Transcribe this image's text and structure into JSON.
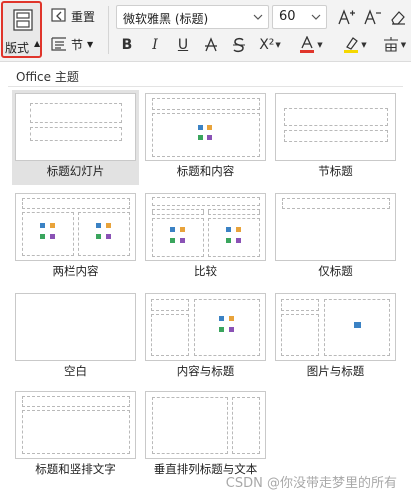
{
  "ribbon": {
    "layout_label": "版式",
    "reset_label": "重置",
    "section_label": "节",
    "font_name": "微软雅黑 (标题)",
    "font_size": "60",
    "colors": {
      "accent_border": "#e0352b",
      "font_color_bar": "#e0352b",
      "highlight_bar": "#f5d800"
    }
  },
  "panel": {
    "title": "Office 主题",
    "layouts": [
      {
        "label": "标题幻灯片"
      },
      {
        "label": "标题和内容"
      },
      {
        "label": "节标题"
      },
      {
        "label": "两栏内容"
      },
      {
        "label": "比较"
      },
      {
        "label": "仅标题"
      },
      {
        "label": "空白"
      },
      {
        "label": "内容与标题"
      },
      {
        "label": "图片与标题"
      },
      {
        "label": "标题和竖排文字"
      },
      {
        "label": "垂直排列标题与文本"
      }
    ]
  },
  "watermark": "CSDN @你没带走梦里的所有"
}
